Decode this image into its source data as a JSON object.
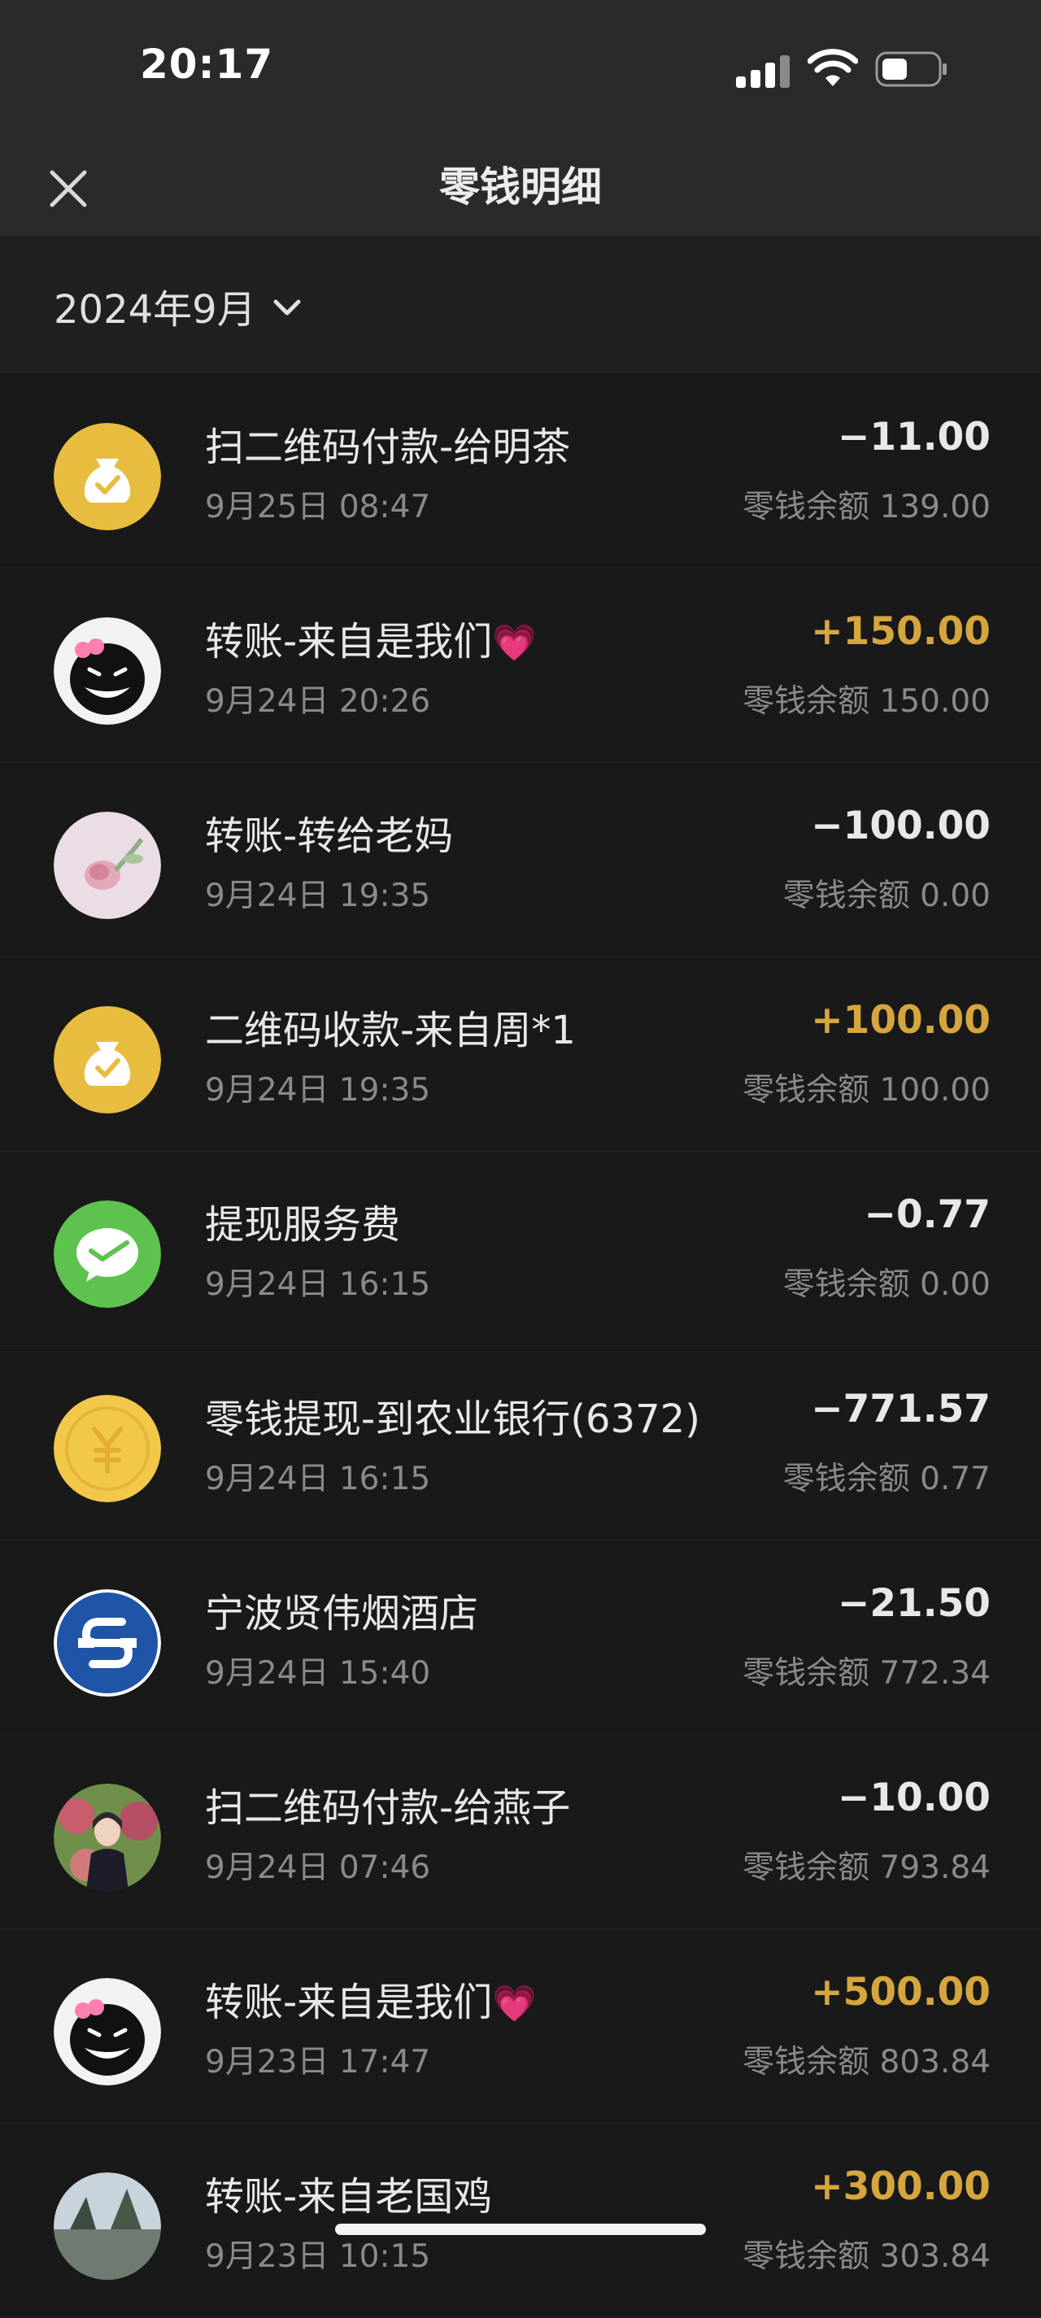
{
  "status_bar": {
    "time": "20:17"
  },
  "nav": {
    "title": "零钱明细"
  },
  "filter": {
    "month": "2024年9月"
  },
  "transactions": [
    {
      "title": "扫二维码付款-给明茶",
      "date": "9月25日 08:47",
      "amount": "−11.00",
      "balance": "零钱余额 139.00",
      "avatar": "money-bag-icon",
      "type": "expense"
    },
    {
      "title": "转账-来自是我们",
      "emoji": "💗",
      "date": "9月24日 20:26",
      "amount": "+150.00",
      "balance": "零钱余额 150.00",
      "avatar": "contact-avatar-black-cat",
      "type": "income"
    },
    {
      "title": "转账-转给老妈",
      "date": "9月24日 19:35",
      "amount": "−100.00",
      "balance": "零钱余额 0.00",
      "avatar": "contact-avatar-roses",
      "type": "expense"
    },
    {
      "title": "二维码收款-来自周*1",
      "date": "9月24日 19:35",
      "amount": "+100.00",
      "balance": "零钱余额 100.00",
      "avatar": "money-bag-icon",
      "type": "income"
    },
    {
      "title": "提现服务费",
      "date": "9月24日 16:15",
      "amount": "−0.77",
      "balance": "零钱余额 0.00",
      "avatar": "wechat-pay-icon",
      "type": "expense"
    },
    {
      "title": "零钱提现-到农业银行(6372)",
      "date": "9月24日 16:15",
      "amount": "−771.57",
      "balance": "零钱余额 0.77",
      "avatar": "yuan-coin-icon",
      "type": "expense"
    },
    {
      "title": "宁波贤伟烟酒店",
      "date": "9月24日 15:40",
      "amount": "−21.50",
      "balance": "零钱余额 772.34",
      "avatar": "merchant-logo-icon",
      "type": "expense"
    },
    {
      "title": "扫二维码付款-给燕子",
      "date": "9月24日 07:46",
      "amount": "−10.00",
      "balance": "零钱余额 793.84",
      "avatar": "contact-avatar-photo",
      "type": "expense"
    },
    {
      "title": "转账-来自是我们",
      "emoji": "💗",
      "date": "9月23日 17:47",
      "amount": "+500.00",
      "balance": "零钱余额 803.84",
      "avatar": "contact-avatar-black-cat",
      "type": "income"
    },
    {
      "title": "转账-来自老国鸡",
      "date": "9月23日 10:15",
      "amount": "+300.00",
      "balance": "零钱余额 303.84",
      "avatar": "contact-avatar-landscape",
      "type": "income"
    }
  ],
  "colors": {
    "background": "#191919",
    "header": "#2a2a2a",
    "income": "#d6a63e",
    "expense": "#e8e8e8",
    "secondary_text": "#8a8a8a",
    "money_bag": "#e8bd3f",
    "wechat_green": "#5ec24f",
    "merchant_blue": "#1f54a6"
  }
}
